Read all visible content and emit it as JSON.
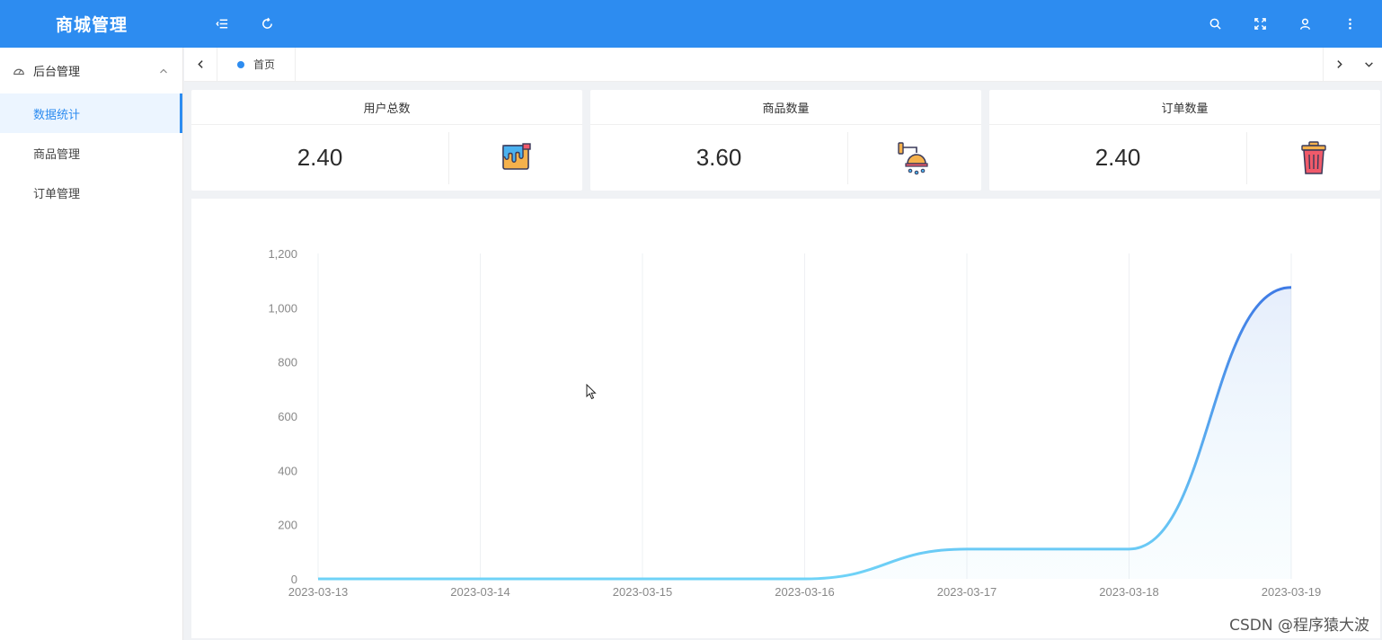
{
  "header": {
    "brand": "商城管理",
    "icons": [
      "menu-fold-icon",
      "refresh-icon",
      "search-icon",
      "fullscreen-icon",
      "user-icon",
      "more-vertical-icon"
    ],
    "color": "#2d8cf0"
  },
  "sidebar": {
    "group": {
      "label": "后台管理",
      "icon": "dashboard-icon",
      "expanded": true
    },
    "items": [
      {
        "label": "数据统计",
        "active": true
      },
      {
        "label": "商品管理",
        "active": false
      },
      {
        "label": "订单管理",
        "active": false
      }
    ]
  },
  "tabs": {
    "items": [
      {
        "label": "首页",
        "active": true
      }
    ]
  },
  "cards": [
    {
      "title": "用户总数",
      "value": "2.40",
      "icon": "paint-bucket-icon"
    },
    {
      "title": "商品数量",
      "value": "3.60",
      "icon": "shower-icon"
    },
    {
      "title": "订单数量",
      "value": "2.40",
      "icon": "trash-bin-icon"
    }
  ],
  "chart_data": {
    "type": "area",
    "x": [
      "2023-03-13",
      "2023-03-14",
      "2023-03-15",
      "2023-03-16",
      "2023-03-17",
      "2023-03-18",
      "2023-03-19"
    ],
    "series": [
      {
        "values": [
          0,
          0,
          0,
          0,
          110,
          110,
          1075
        ]
      }
    ],
    "ylim": [
      0,
      1200
    ],
    "yticks": [
      "0",
      "200",
      "400",
      "600",
      "800",
      "1,000",
      "1,200"
    ],
    "grid": "vertical",
    "smooth": true,
    "line_color_start": "#6fd3f7",
    "line_color_end": "#3f7be5"
  },
  "watermark": "CSDN @程序猿大波"
}
